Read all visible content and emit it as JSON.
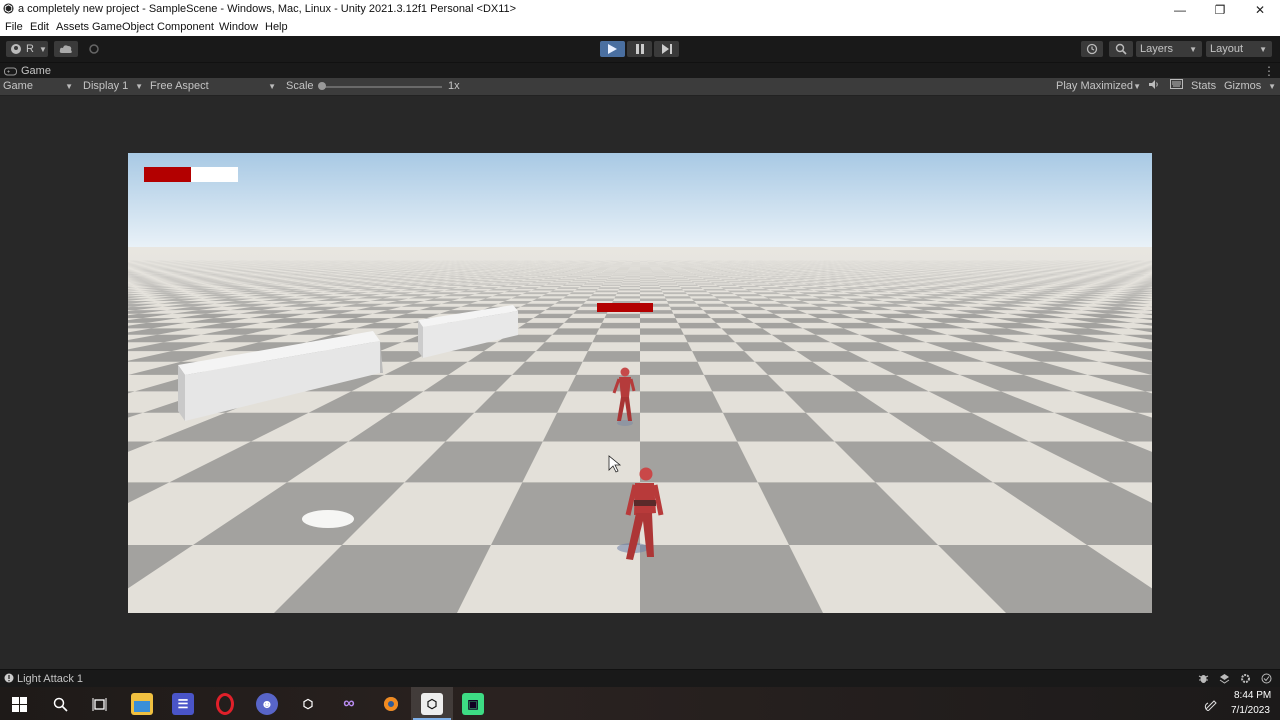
{
  "window": {
    "title": "a completely new project - SampleScene - Windows, Mac, Linux - Unity 2021.3.12f1 Personal <DX11>",
    "icon": "unity-icon"
  },
  "menu": [
    "File",
    "Edit",
    "Assets",
    "GameObject",
    "Component",
    "Window",
    "Help"
  ],
  "toolbar": {
    "account_label": "R",
    "layers_label": "Layers",
    "layout_label": "Layout"
  },
  "tab": {
    "label": "Game"
  },
  "gamebar": {
    "view_mode": "Game",
    "display": "Display 1",
    "aspect": "Free Aspect",
    "scale_label": "Scale",
    "scale_value": "1x",
    "play_mode": "Play Maximized",
    "stats_label": "Stats",
    "gizmos_label": "Gizmos"
  },
  "game": {
    "player_health_fraction": 0.5,
    "health_color": "#b30000",
    "enemy_health_fraction": 1.0,
    "sky_top": "#a9cbe6",
    "ground_light": "#e3e0d9",
    "ground_dark": "#a3a29f"
  },
  "status": {
    "message": "Light Attack 1"
  },
  "taskbar": {
    "time": "8:44 PM",
    "date": "7/1/2023",
    "apps": [
      "file-explorer-icon",
      "visual-studio-icon",
      "opera-icon",
      "discord-icon",
      "unity-hub-icon",
      "vs-icon",
      "blender-icon",
      "unity-icon",
      "android-studio-icon"
    ]
  }
}
